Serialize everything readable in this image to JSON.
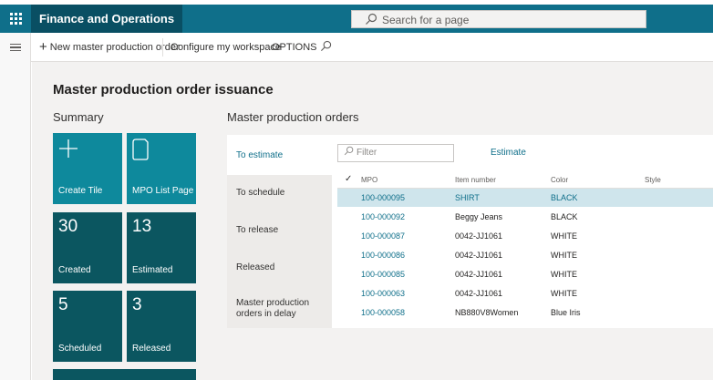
{
  "app": {
    "name": "Finance and Operations",
    "search_placeholder": "Search for a page"
  },
  "actions": {
    "new_order": "New master production order",
    "configure": "Configure my workspace",
    "options": "OPTIONS"
  },
  "workspace": {
    "title": "Master production order issuance",
    "summary_title": "Summary",
    "orders_title": "Master production orders"
  },
  "tiles": {
    "create": {
      "label": "Create Tile"
    },
    "mpo_list": {
      "label": "MPO List Page"
    },
    "created": {
      "value": "30",
      "label": "Created"
    },
    "estimated": {
      "value": "13",
      "label": "Estimated"
    },
    "scheduled": {
      "value": "5",
      "label": "Scheduled"
    },
    "released": {
      "value": "3",
      "label": "Released"
    }
  },
  "tabs": [
    {
      "label": "To estimate"
    },
    {
      "label": "To schedule"
    },
    {
      "label": "To release"
    },
    {
      "label": "Released"
    },
    {
      "label": "Master production orders in delay"
    }
  ],
  "grid": {
    "filter_placeholder": "Filter",
    "estimate_action": "Estimate",
    "columns": [
      "MPO",
      "Item number",
      "Color",
      "Style"
    ],
    "rows": [
      {
        "mpo": "100-000095",
        "item": "SHIRT",
        "color": "BLACK",
        "style": ""
      },
      {
        "mpo": "100-000092",
        "item": "Beggy Jeans",
        "color": "BLACK",
        "style": ""
      },
      {
        "mpo": "100-000087",
        "item": "0042-JJ1061",
        "color": "WHITE",
        "style": ""
      },
      {
        "mpo": "100-000086",
        "item": "0042-JJ1061",
        "color": "WHITE",
        "style": ""
      },
      {
        "mpo": "100-000085",
        "item": "0042-JJ1061",
        "color": "WHITE",
        "style": ""
      },
      {
        "mpo": "100-000063",
        "item": "0042-JJ1061",
        "color": "WHITE",
        "style": ""
      },
      {
        "mpo": "100-000058",
        "item": "NB880V8Women",
        "color": "Blue Iris",
        "style": ""
      }
    ]
  },
  "icons": [
    "waffle-icon",
    "search-icon",
    "hamburger-icon",
    "plus-icon",
    "page-icon",
    "check-icon"
  ],
  "colors": {
    "brand": "#0f6f8a",
    "tile_teal": "#0e899c",
    "tile_dark": "#0b5660",
    "selected_row": "#cfe5ec"
  }
}
